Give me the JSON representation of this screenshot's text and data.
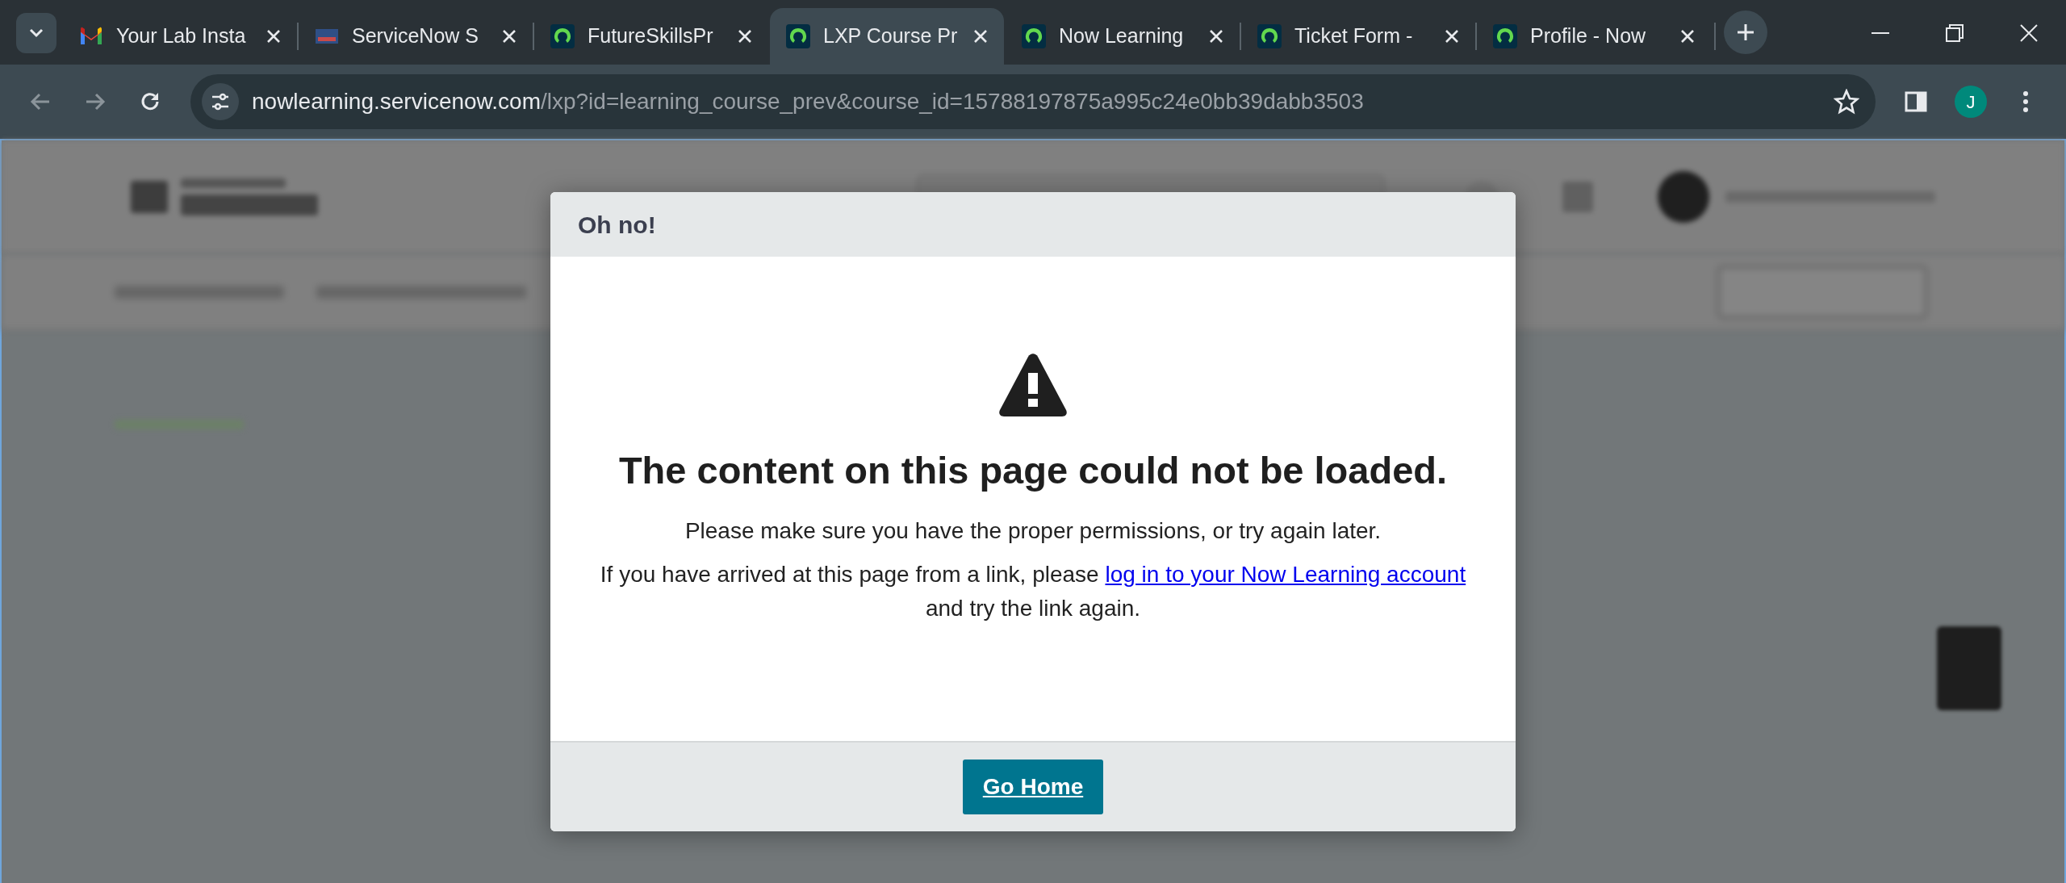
{
  "browser": {
    "tabs": [
      {
        "title": "Your Lab Insta",
        "kind": "mail",
        "selected": false
      },
      {
        "title": "ServiceNow S",
        "kind": "screen",
        "selected": false
      },
      {
        "title": "FutureSkillsPr",
        "kind": "ring",
        "selected": false
      },
      {
        "title": "LXP Course Pr",
        "kind": "ring",
        "selected": true
      },
      {
        "title": "Now Learning",
        "kind": "ring",
        "selected": false
      },
      {
        "title": "Ticket Form -",
        "kind": "ring",
        "selected": false
      },
      {
        "title": "Profile - Now",
        "kind": "ring",
        "selected": false
      }
    ],
    "address_bar": {
      "host": "nowlearning.servicenow.com",
      "path": "/lxp?id=learning_course_prev&course_id=15788197875a995c24e0bb39dabb3503"
    },
    "profile_initial": "J"
  },
  "modal": {
    "title": "Oh no!",
    "heading": "The content on this page could not be loaded.",
    "message": "Please make sure you have the proper permissions, or try again later.",
    "help_before": "If you have arrived at this page from a link, please",
    "link": "log in to your Now Learning account",
    "help_after": "and try the link again.",
    "button": "Go Home"
  }
}
